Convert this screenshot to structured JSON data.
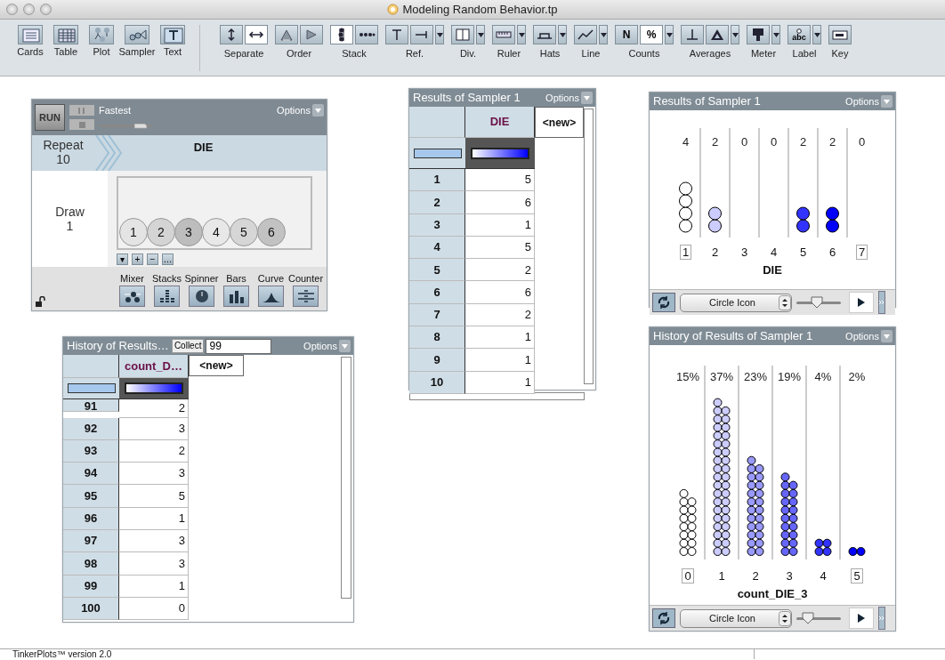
{
  "window": {
    "title": "Modeling Random Behavior.tp"
  },
  "toolbar": {
    "objects": [
      {
        "label": "Cards",
        "kind": "cards"
      },
      {
        "label": "Table",
        "kind": "table"
      },
      {
        "label": "Plot",
        "kind": "plot"
      },
      {
        "label": "Sampler",
        "kind": "sampler"
      },
      {
        "label": "Text",
        "kind": "text"
      }
    ],
    "groups": [
      {
        "label": "Separate",
        "menu": false,
        "buttons": [
          {
            "kind": "vertical",
            "selected": false
          },
          {
            "kind": "horizontal",
            "selected": true
          }
        ]
      },
      {
        "label": "Order",
        "menu": false,
        "buttons": [
          {
            "kind": "order-up",
            "selected": false
          },
          {
            "kind": "order-right",
            "selected": false
          }
        ]
      },
      {
        "label": "Stack",
        "menu": false,
        "buttons": [
          {
            "kind": "stack-vertical",
            "selected": true
          },
          {
            "kind": "stack-horizontal",
            "selected": false
          }
        ]
      },
      {
        "label": "Ref.",
        "menu": true,
        "buttons": [
          {
            "kind": "ref-vertical",
            "selected": false
          },
          {
            "kind": "ref-horizontal",
            "selected": false
          }
        ]
      },
      {
        "label": "Div.",
        "menu": true,
        "buttons": [
          {
            "kind": "divider",
            "selected": false
          }
        ]
      },
      {
        "label": "Ruler",
        "menu": true,
        "buttons": [
          {
            "kind": "ruler",
            "selected": false
          }
        ]
      },
      {
        "label": "Hats",
        "menu": true,
        "buttons": [
          {
            "kind": "hat",
            "selected": false
          }
        ]
      },
      {
        "label": "Line",
        "menu": true,
        "buttons": [
          {
            "kind": "line",
            "selected": false
          }
        ]
      },
      {
        "label": "Counts",
        "menu": true,
        "buttons": [
          {
            "kind": "text",
            "text": "N",
            "selected": false
          },
          {
            "kind": "text",
            "text": "%",
            "selected": true
          }
        ]
      },
      {
        "label": "Averages",
        "menu": true,
        "buttons": [
          {
            "kind": "mean",
            "selected": false
          },
          {
            "kind": "triangle",
            "selected": false
          }
        ]
      },
      {
        "label": "Meter",
        "menu": true,
        "buttons": [
          {
            "kind": "meter",
            "selected": false
          }
        ]
      },
      {
        "label": "Label",
        "menu": true,
        "buttons": [
          {
            "kind": "label",
            "text": "abc",
            "selected": false
          }
        ]
      },
      {
        "label": "Key",
        "menu": false,
        "buttons": [
          {
            "kind": "key",
            "selected": false
          }
        ]
      }
    ]
  },
  "sampler": {
    "run_label": "RUN",
    "speed_label": "Fastest",
    "speed": {
      "level": 0.85
    },
    "options_label": "Options",
    "repeat": {
      "label": "Repeat",
      "value": "10"
    },
    "attribute": "DIE",
    "draw": {
      "label": "Draw",
      "value": "1"
    },
    "balls": [
      {
        "label": "1",
        "color": "#e4e4e4"
      },
      {
        "label": "2",
        "color": "#d4d4d4"
      },
      {
        "label": "3",
        "color": "#bdbdbd"
      },
      {
        "label": "4",
        "color": "#e8e8e8"
      },
      {
        "label": "5",
        "color": "#d6d6d6"
      },
      {
        "label": "6",
        "color": "#c2c2c2"
      }
    ],
    "edit_buttons": [
      "▾",
      "+",
      "−",
      "…"
    ],
    "locked": false,
    "devices": [
      {
        "label": "Mixer",
        "kind": "mixer"
      },
      {
        "label": "Stacks",
        "kind": "stacks"
      },
      {
        "label": "Spinner",
        "kind": "spinner"
      },
      {
        "label": "Bars",
        "kind": "bars"
      },
      {
        "label": "Curve",
        "kind": "curve"
      },
      {
        "label": "Counter",
        "kind": "counter"
      }
    ]
  },
  "results_table": {
    "title": "Results of Sampler 1",
    "options_label": "Options",
    "columns": [
      "DIE",
      "<new>"
    ],
    "rows": [
      {
        "index": "1",
        "value": "5"
      },
      {
        "index": "2",
        "value": "6"
      },
      {
        "index": "3",
        "value": "1"
      },
      {
        "index": "4",
        "value": "5"
      },
      {
        "index": "5",
        "value": "2"
      },
      {
        "index": "6",
        "value": "6"
      },
      {
        "index": "7",
        "value": "2"
      },
      {
        "index": "8",
        "value": "1"
      },
      {
        "index": "9",
        "value": "1"
      },
      {
        "index": "10",
        "value": "1"
      }
    ]
  },
  "results_plot": {
    "title": "Results of Sampler 1",
    "options_label": "Options",
    "bins": [
      {
        "label": "1",
        "count": "4"
      },
      {
        "label": "2",
        "count": "2"
      },
      {
        "label": "3",
        "count": "0"
      },
      {
        "label": "4",
        "count": "0"
      },
      {
        "label": "5",
        "count": "2"
      },
      {
        "label": "6",
        "count": "2"
      },
      {
        "label": "7",
        "count": "0"
      }
    ],
    "xlabel": "DIE",
    "icon_menu": "Circle Icon",
    "icon_size": {
      "level": 0.45
    }
  },
  "history_table": {
    "title": "History of Results…",
    "collect_label": "Collect",
    "collect_value": "99",
    "options_label": "Options",
    "columns": [
      "count_D…",
      "<new>"
    ],
    "rows": [
      {
        "index": "91",
        "value": "2"
      },
      {
        "index": "92",
        "value": "3"
      },
      {
        "index": "93",
        "value": "2"
      },
      {
        "index": "94",
        "value": "3"
      },
      {
        "index": "95",
        "value": "5"
      },
      {
        "index": "96",
        "value": "1"
      },
      {
        "index": "97",
        "value": "3"
      },
      {
        "index": "98",
        "value": "3"
      },
      {
        "index": "99",
        "value": "1"
      },
      {
        "index": "100",
        "value": "0"
      }
    ]
  },
  "history_plot": {
    "title": "History of Results of Sampler 1",
    "options_label": "Options",
    "bins": [
      {
        "label": "0",
        "count": "15%"
      },
      {
        "label": "1",
        "count": "37%"
      },
      {
        "label": "2",
        "count": "23%"
      },
      {
        "label": "3",
        "count": "19%"
      },
      {
        "label": "4",
        "count": "4%"
      },
      {
        "label": "5",
        "count": "2%"
      }
    ],
    "xlabel": "count_DIE_3",
    "icon_menu": "Circle Icon",
    "icon_size": {
      "level": 0.25
    }
  },
  "status_bar": "TinkerPlots™ version 2.0"
}
